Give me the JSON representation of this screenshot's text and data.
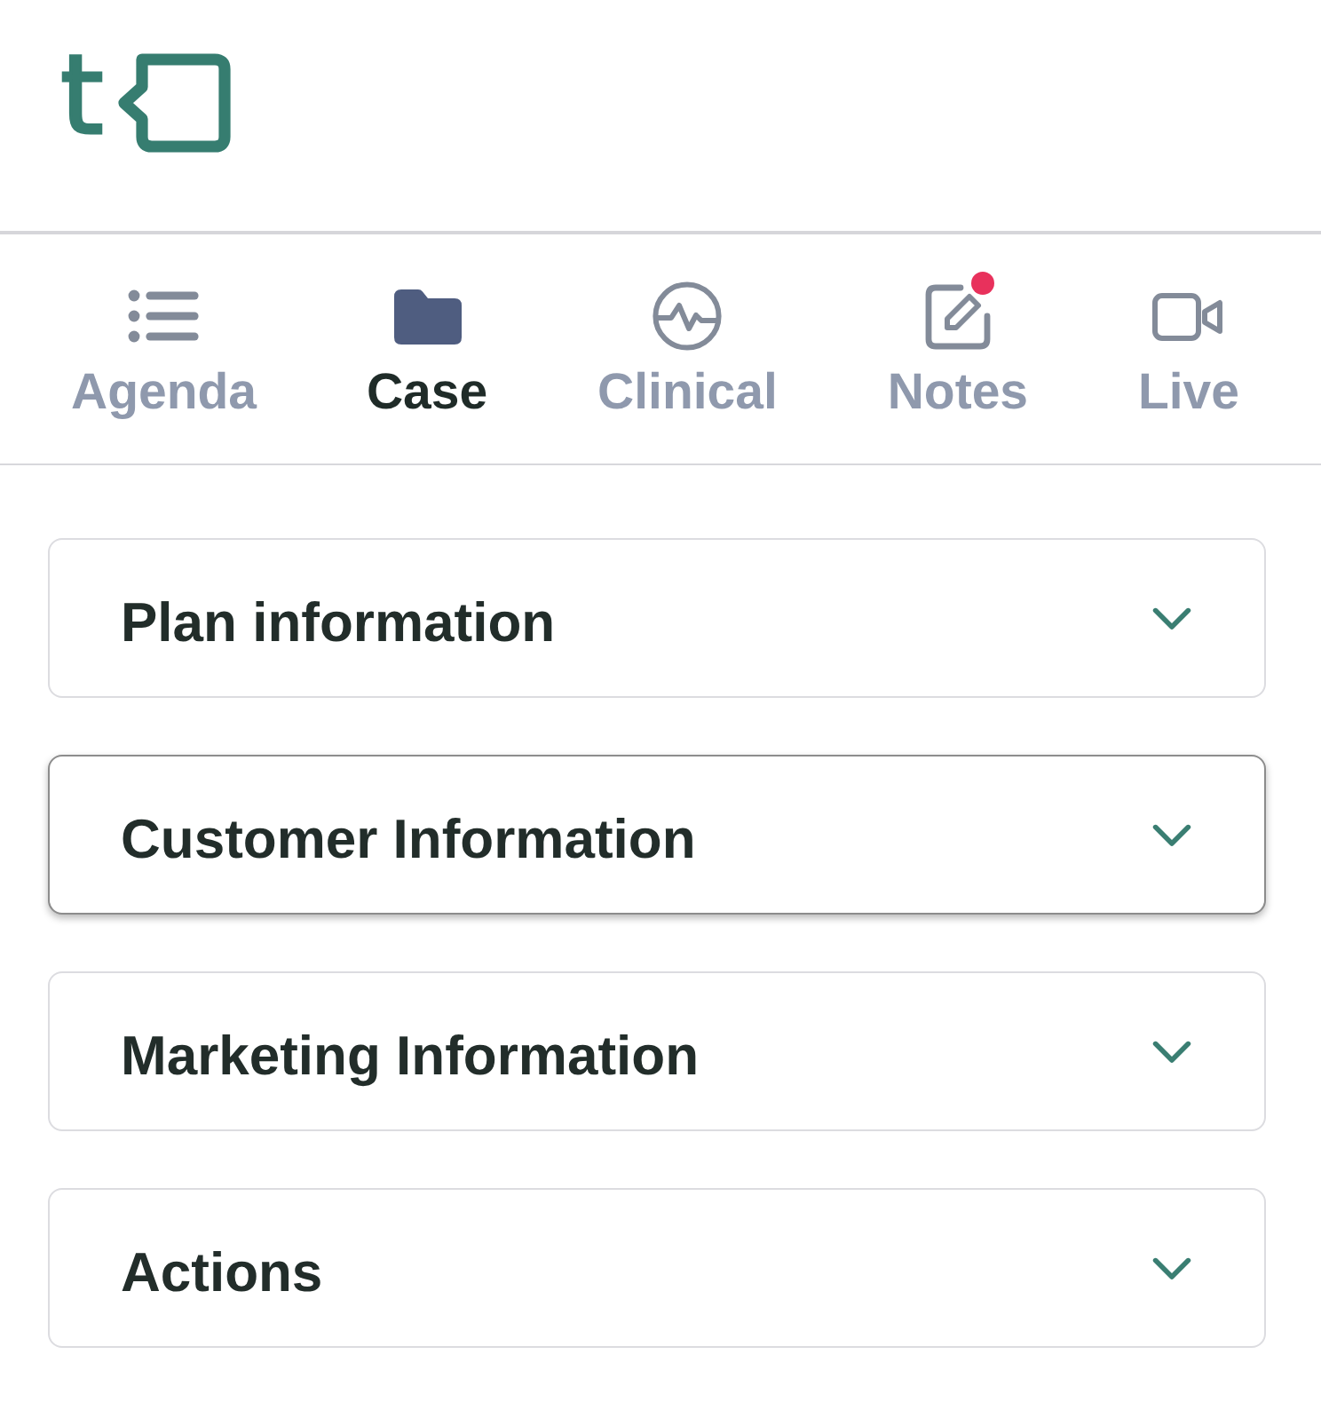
{
  "logo": {
    "text": "t"
  },
  "tabs": [
    {
      "label": "Agenda",
      "selected": false,
      "badge": false
    },
    {
      "label": "Case",
      "selected": true,
      "badge": false
    },
    {
      "label": "Clinical",
      "selected": false,
      "badge": false
    },
    {
      "label": "Notes",
      "selected": false,
      "badge": true
    },
    {
      "label": "Live",
      "selected": false,
      "badge": false
    }
  ],
  "sections": [
    {
      "title": "Plan information",
      "expanded": false,
      "focused": false
    },
    {
      "title": "Customer Information",
      "expanded": false,
      "focused": true
    },
    {
      "title": "Marketing Information",
      "expanded": false,
      "focused": false
    },
    {
      "title": "Actions",
      "expanded": false,
      "focused": false
    }
  ]
}
